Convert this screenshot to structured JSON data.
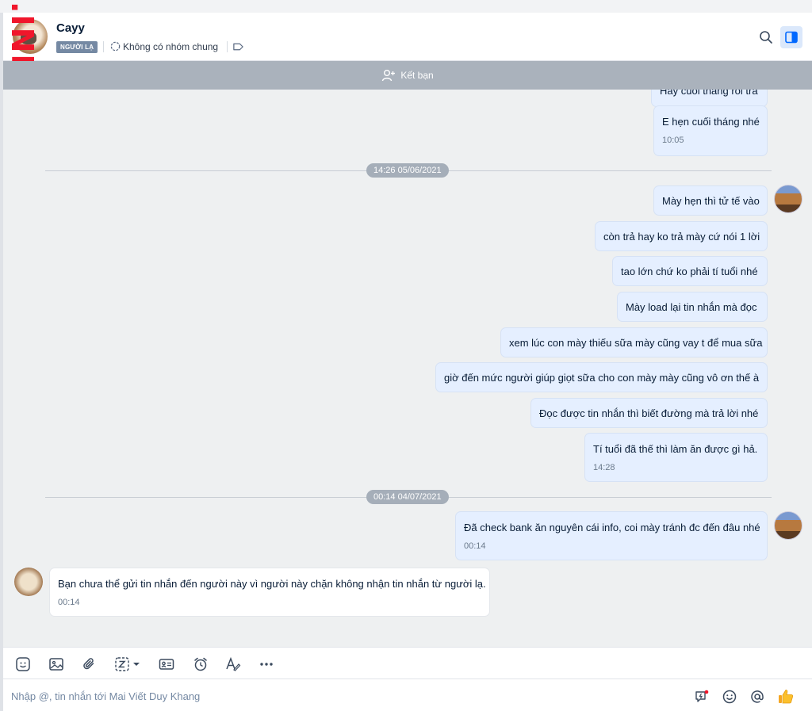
{
  "header": {
    "contact_name": "Cayy",
    "badge": "NGƯỜI LẠ",
    "group_info": "Không có nhóm chung"
  },
  "watermark": ".INFO",
  "friend_bar": {
    "label": "Kết bạn"
  },
  "messages": [
    {
      "id": "m0",
      "text": "Hay cuối tháng rồi trả",
      "time": ""
    },
    {
      "id": "m1",
      "text": "E hẹn cuối tháng nhé",
      "time": "10:05"
    },
    {
      "id": "d1",
      "text": "14:26 05/06/2021"
    },
    {
      "id": "m2",
      "text": "Mày hẹn thì tử tế vào"
    },
    {
      "id": "m3",
      "text": "còn trả hay ko trả mày cứ nói 1 lời"
    },
    {
      "id": "m4",
      "text": "tao lớn chứ ko phải tí tuổi nhé"
    },
    {
      "id": "m5",
      "text": "Mày load lại tin nhắn mà đọc"
    },
    {
      "id": "m6",
      "text": "xem lúc con mày thiếu sữa mày cũng vay t để mua sữa"
    },
    {
      "id": "m7",
      "text": "giờ đến mức người giúp giọt sữa cho con mày mày cũng vô ơn thế à"
    },
    {
      "id": "m8",
      "text": "Đọc được tin nhắn thì biết đường mà trả lời nhé"
    },
    {
      "id": "m9",
      "text": "Tí tuổi đã thế thì làm ăn được gì hả.",
      "time": "14:28"
    },
    {
      "id": "d2",
      "text": "00:14 04/07/2021"
    },
    {
      "id": "m10",
      "text": "Đã check bank ăn nguyên cái info, coi mày tránh đc đến đâu nhé",
      "time": "00:14"
    },
    {
      "id": "m11",
      "text": "Bạn chưa thể gửi tin nhắn đến người này vì người này chặn không nhận tin nhắn từ người lạ.",
      "time": "00:14"
    }
  ],
  "composer": {
    "placeholder": "Nhập @, tin nhắn tới Mai Viết Duy Khang"
  },
  "icons": {
    "toolbar": [
      "sticker-icon",
      "image-icon",
      "attachment-icon",
      "zstyle-icon",
      "contact-card-icon",
      "reminder-icon",
      "text-format-icon",
      "more-icon"
    ],
    "composer": [
      "quick-message-icon",
      "emoji-icon",
      "mention-icon",
      "thumbs-up-icon"
    ]
  },
  "colors": {
    "accent": "#0068ff",
    "bubble_self": "#e5efff",
    "badge_bg": "#7589a3",
    "friend_bar_bg": "#aab2bc",
    "watermark": "#f0162b"
  }
}
